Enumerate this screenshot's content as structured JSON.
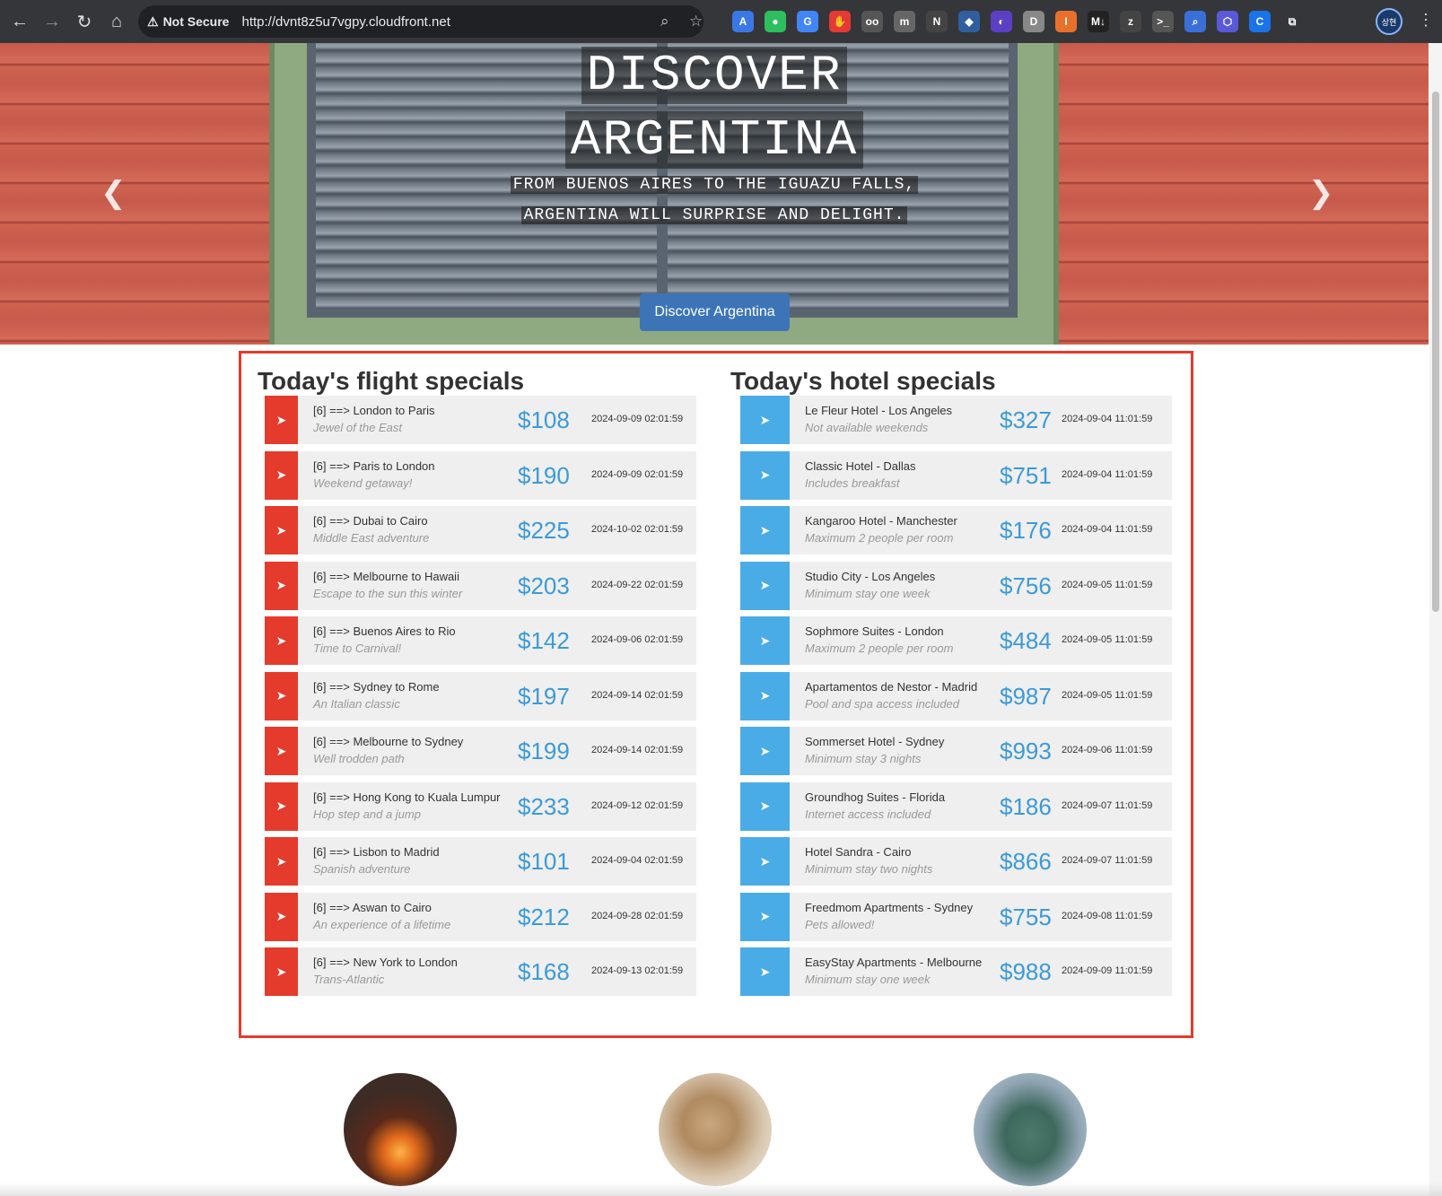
{
  "browser": {
    "security_label": "Not Secure",
    "url": "http://dvnt8z5u7vgpy.cloudfront.net",
    "profile_label": "상현",
    "extensions": [
      {
        "name": "translate-a-icon",
        "color": "#3b78e7",
        "glyph": "A"
      },
      {
        "name": "evernote-icon",
        "color": "#2dbe60",
        "glyph": "●"
      },
      {
        "name": "google-translate-icon",
        "color": "#4285f4",
        "glyph": "G"
      },
      {
        "name": "hand-stop-icon",
        "color": "#e53935",
        "glyph": "✋"
      },
      {
        "name": "glasses-icon",
        "color": "#555555",
        "glyph": "oo"
      },
      {
        "name": "m-italic-icon",
        "color": "#666666",
        "glyph": "m"
      },
      {
        "name": "notion-icon",
        "color": "#444444",
        "glyph": "N"
      },
      {
        "name": "cube-icon",
        "color": "#2f5f9e",
        "glyph": "◆"
      },
      {
        "name": "obsidian-icon",
        "color": "#5b3fc4",
        "glyph": "◐"
      },
      {
        "name": "d-icon",
        "color": "#888888",
        "glyph": "D"
      },
      {
        "name": "orange-circle-icon",
        "color": "#e8702a",
        "glyph": "I"
      },
      {
        "name": "markdown-icon",
        "color": "#222222",
        "glyph": "M↓"
      },
      {
        "name": "zotero-icon",
        "color": "#444444",
        "glyph": "z"
      },
      {
        "name": "terminal-icon",
        "color": "#555555",
        "glyph": ">_"
      },
      {
        "name": "search-ext-icon",
        "color": "#3a6fd8",
        "glyph": "⌕"
      },
      {
        "name": "hexagon-icon",
        "color": "#5a5ad8",
        "glyph": "⬡"
      },
      {
        "name": "c-icon",
        "color": "#1a73e8",
        "glyph": "C"
      },
      {
        "name": "puzzle-icon",
        "color": "#35363a",
        "glyph": "⧉"
      }
    ]
  },
  "hero": {
    "title_line1": "DISCOVER",
    "title_line2": "ARGENTINA",
    "subtitle_line1": "FROM BUENOS AIRES TO THE IGUAZU FALLS,",
    "subtitle_line2": "ARGENTINA WILL SURPRISE AND DELIGHT.",
    "button_label": "Discover Argentina",
    "slide_count": 3,
    "active_slide": 3
  },
  "flights": {
    "title": "Today's flight specials",
    "accent": "#e53b2c",
    "items": [
      {
        "name": "[6] ==> London to Paris",
        "desc": "Jewel of the East",
        "price": "$108",
        "date": "2024-09-09 02:01:59"
      },
      {
        "name": "[6] ==> Paris to London",
        "desc": "Weekend getaway!",
        "price": "$190",
        "date": "2024-09-09 02:01:59"
      },
      {
        "name": "[6] ==> Dubai to Cairo",
        "desc": "Middle East adventure",
        "price": "$225",
        "date": "2024-10-02 02:01:59"
      },
      {
        "name": "[6] ==> Melbourne to Hawaii",
        "desc": "Escape to the sun this winter",
        "price": "$203",
        "date": "2024-09-22 02:01:59"
      },
      {
        "name": "[6] ==> Buenos Aires to Rio",
        "desc": "Time to Carnival!",
        "price": "$142",
        "date": "2024-09-06 02:01:59"
      },
      {
        "name": "[6] ==> Sydney to Rome",
        "desc": "An Italian classic",
        "price": "$197",
        "date": "2024-09-14 02:01:59"
      },
      {
        "name": "[6] ==> Melbourne to Sydney",
        "desc": "Well trodden path",
        "price": "$199",
        "date": "2024-09-14 02:01:59"
      },
      {
        "name": "[6] ==> Hong Kong to Kuala Lumpur",
        "desc": "Hop step and a jump",
        "price": "$233",
        "date": "2024-09-12 02:01:59"
      },
      {
        "name": "[6] ==> Lisbon to Madrid",
        "desc": "Spanish adventure",
        "price": "$101",
        "date": "2024-09-04 02:01:59"
      },
      {
        "name": "[6] ==> Aswan to Cairo",
        "desc": "An experience of a lifetime",
        "price": "$212",
        "date": "2024-09-28 02:01:59"
      },
      {
        "name": "[6] ==> New York to London",
        "desc": "Trans-Atlantic",
        "price": "$168",
        "date": "2024-09-13 02:01:59"
      }
    ]
  },
  "hotels": {
    "title": "Today's hotel specials",
    "accent": "#4aace6",
    "items": [
      {
        "name": "Le Fleur Hotel - Los Angeles",
        "desc": "Not available weekends",
        "price": "$327",
        "date": "2024-09-04 11:01:59"
      },
      {
        "name": "Classic Hotel - Dallas",
        "desc": "Includes breakfast",
        "price": "$751",
        "date": "2024-09-04 11:01:59"
      },
      {
        "name": "Kangaroo Hotel - Manchester",
        "desc": "Maximum 2 people per room",
        "price": "$176",
        "date": "2024-09-04 11:01:59"
      },
      {
        "name": "Studio City - Los Angeles",
        "desc": "Minimum stay one week",
        "price": "$756",
        "date": "2024-09-05 11:01:59"
      },
      {
        "name": "Sophmore Suites - London",
        "desc": "Maximum 2 people per room",
        "price": "$484",
        "date": "2024-09-05 11:01:59"
      },
      {
        "name": "Apartamentos de Nestor - Madrid",
        "desc": "Pool and spa access included",
        "price": "$987",
        "date": "2024-09-05 11:01:59"
      },
      {
        "name": "Sommerset Hotel - Sydney",
        "desc": "Minimum stay 3 nights",
        "price": "$993",
        "date": "2024-09-06 11:01:59"
      },
      {
        "name": "Groundhog Suites - Florida",
        "desc": "Internet access included",
        "price": "$186",
        "date": "2024-09-07 11:01:59"
      },
      {
        "name": "Hotel Sandra - Cairo",
        "desc": "Minimum stay two nights",
        "price": "$866",
        "date": "2024-09-07 11:01:59"
      },
      {
        "name": "Freedmom Apartments - Sydney",
        "desc": "Pets allowed!",
        "price": "$755",
        "date": "2024-09-08 11:01:59"
      },
      {
        "name": "EasyStay Apartments - Melbourne",
        "desc": "Minimum stay one week",
        "price": "$988",
        "date": "2024-09-09 11:01:59"
      }
    ]
  },
  "destinations": [
    {
      "name": "destination-image-lava",
      "icon": "volcano-photo"
    },
    {
      "name": "destination-image-sphinx",
      "icon": "sphinx-photo"
    },
    {
      "name": "destination-image-statue",
      "icon": "statue-of-liberty-photo"
    }
  ]
}
